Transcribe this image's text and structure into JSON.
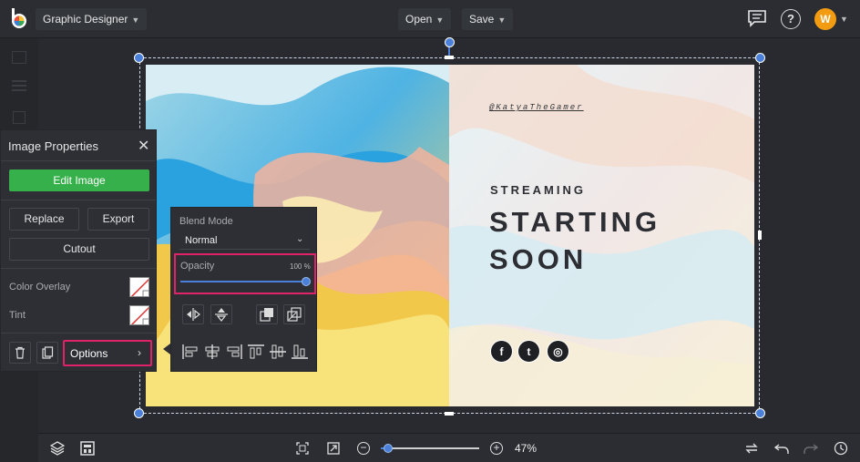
{
  "topbar": {
    "project_name": "Graphic Designer",
    "open_label": "Open",
    "save_label": "Save",
    "avatar_initial": "W",
    "accent_color": "#f39c12"
  },
  "canvas": {
    "handle": "@KatyaTheGamer",
    "subtitle": "STREAMING",
    "title_line1": "STARTING",
    "title_line2": "SOON",
    "socials": [
      {
        "label": "f",
        "icon": "facebook-icon"
      },
      {
        "label": "t",
        "icon": "tumblr-icon"
      },
      {
        "label": "◎",
        "icon": "instagram-icon"
      }
    ]
  },
  "props": {
    "title": "Image Properties",
    "edit_image": "Edit Image",
    "replace": "Replace",
    "export": "Export",
    "cutout": "Cutout",
    "color_overlay": "Color Overlay",
    "tint": "Tint",
    "options": "Options"
  },
  "blend": {
    "title": "Blend Mode",
    "mode_value": "Normal",
    "opacity_label": "Opacity",
    "opacity_value": "100 %",
    "opacity_fraction": 1.0
  },
  "bottombar": {
    "zoom_label": "47%",
    "zoom_fraction": 0.05
  },
  "colors": {
    "accent_blue": "#4a80d9",
    "highlight_pink": "#e0226b",
    "edit_green": "#35b04a"
  }
}
